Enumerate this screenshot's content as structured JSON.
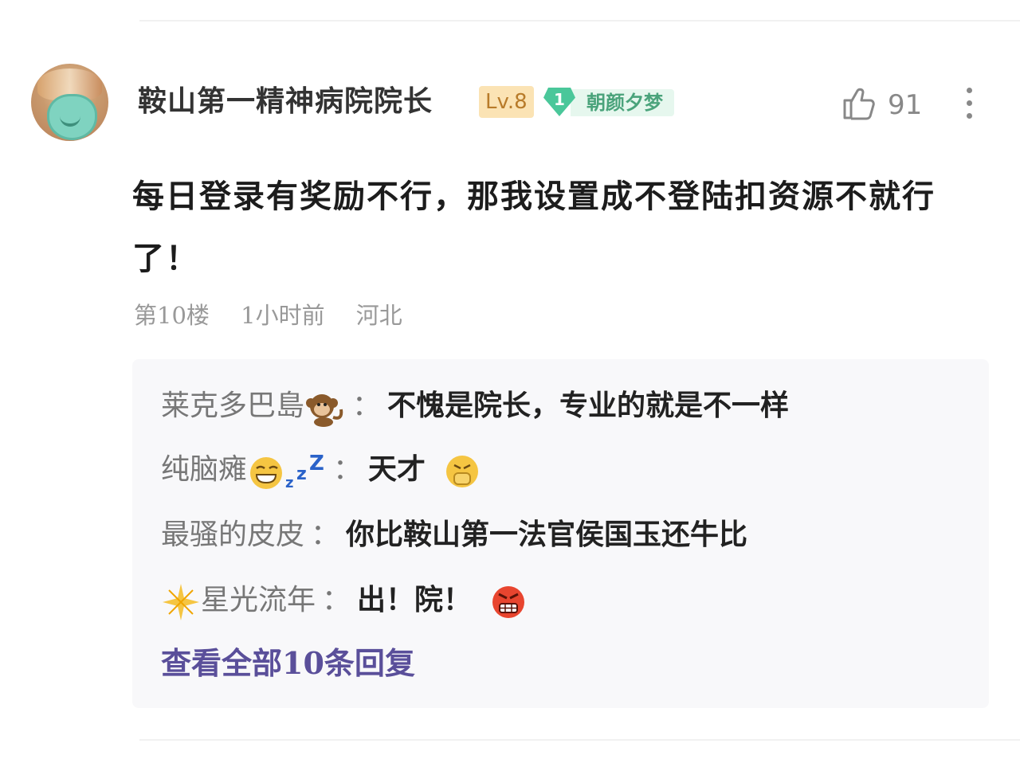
{
  "comment": {
    "author": "鞍山第一精神病院院长",
    "level": "Lv.8",
    "fan_badge_level": "1",
    "fan_badge_name": "朝颜夕梦",
    "likes": "91",
    "text": "每日登录有奖励不行，那我设置成不登陆扣资源不就行了！",
    "floor": "第10楼",
    "time": "1小时前",
    "location": "河北"
  },
  "replies": [
    {
      "name": "莱克多巴島",
      "icon": "monkey-icon",
      "sep": "：",
      "text": "不愧是院长，专业的就是不一样"
    },
    {
      "name": "纯脑瘫",
      "icon": "sleepy-grin-icon",
      "sep": "：",
      "text": "天才",
      "trail_icon": "fist-face-icon"
    },
    {
      "name": "最骚的皮皮",
      "sep": "：",
      "text": "你比鞍山第一法官侯国玉还牛比"
    },
    {
      "name": "星光流年",
      "lead_icon": "sparkle-icon",
      "sep": "：",
      "text": "出！院！",
      "trail_icon": "angry-face-icon"
    }
  ],
  "view_all": "查看全部10条回复",
  "colors": {
    "level_bg": "#fbe3b4",
    "fan_green": "#4ac79a",
    "link_purple": "#5a4f9a"
  }
}
